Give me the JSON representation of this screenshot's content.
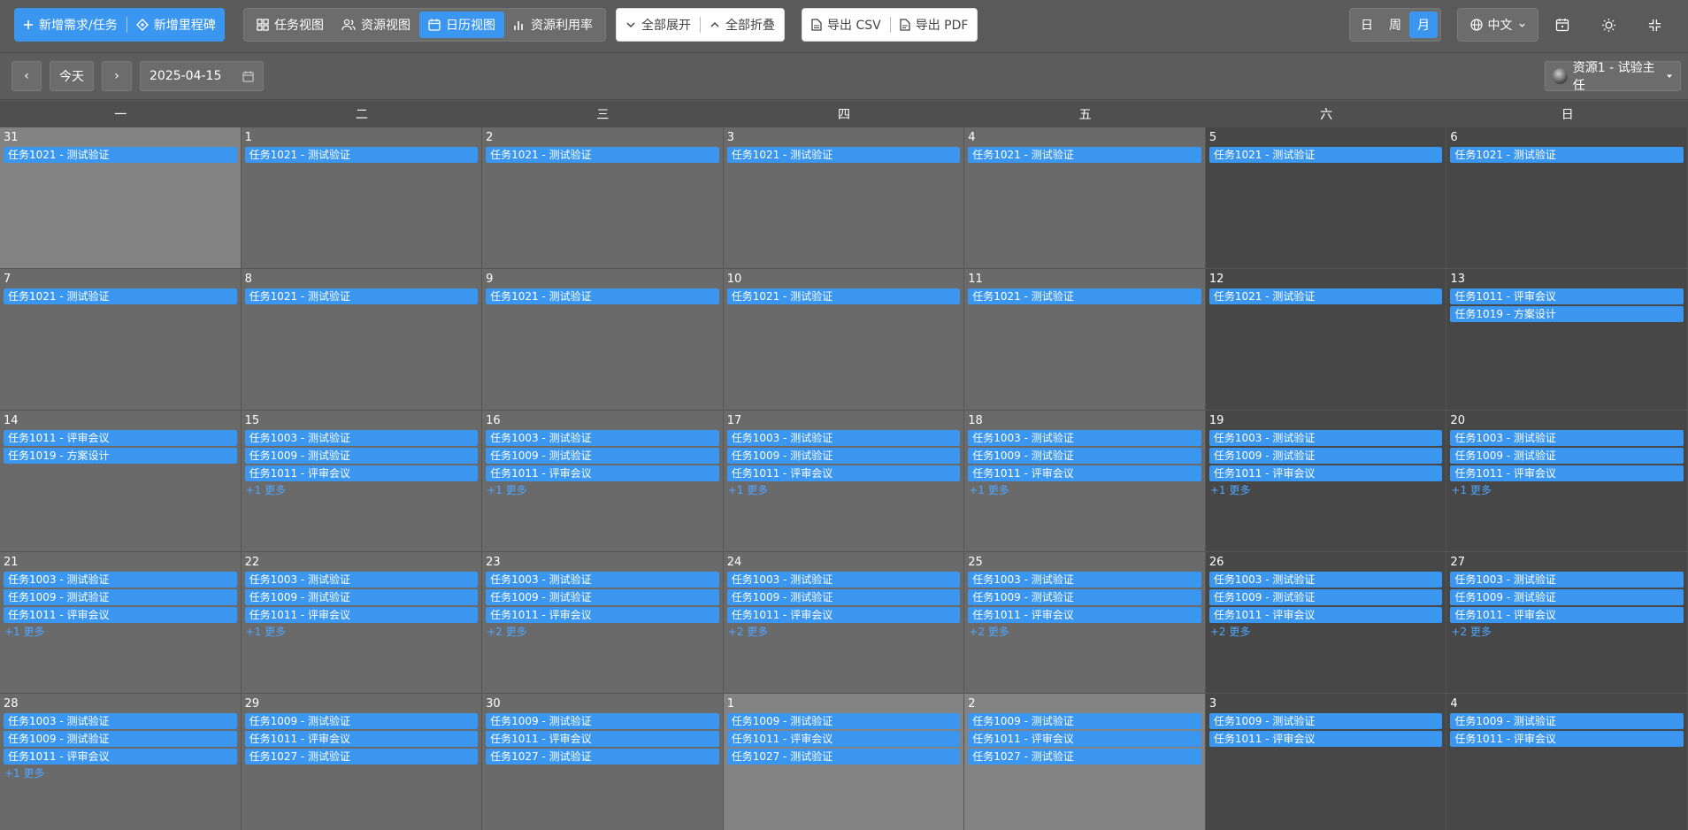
{
  "toolbar": {
    "add_task": "新增需求/任务",
    "add_milestone": "新增里程碑",
    "view_task": "任务视图",
    "view_resource": "资源视图",
    "view_calendar": "日历视图",
    "view_utilization": "资源利用率",
    "expand_all": "全部展开",
    "collapse_all": "全部折叠",
    "export_csv": "导出 CSV",
    "export_pdf": "导出 PDF",
    "period_day": "日",
    "period_week": "周",
    "period_month": "月",
    "language": "中文",
    "accent_color": "#3a96ee"
  },
  "subbar": {
    "prev": "‹",
    "today": "今天",
    "next": "›",
    "date": "2025-04-15",
    "resource": "资源1 - 试验主任"
  },
  "calendar": {
    "weekdays": [
      "一",
      "二",
      "三",
      "四",
      "五",
      "六",
      "日"
    ],
    "weeks": [
      [
        {
          "day": "31",
          "other": true,
          "events": [
            "任务1021 - 测试验证"
          ],
          "more": ""
        },
        {
          "day": "1",
          "events": [
            "任务1021 - 测试验证"
          ],
          "more": ""
        },
        {
          "day": "2",
          "events": [
            "任务1021 - 测试验证"
          ],
          "more": ""
        },
        {
          "day": "3",
          "events": [
            "任务1021 - 测试验证"
          ],
          "more": ""
        },
        {
          "day": "4",
          "events": [
            "任务1021 - 测试验证"
          ],
          "more": ""
        },
        {
          "day": "5",
          "events": [
            "任务1021 - 测试验证"
          ],
          "more": ""
        },
        {
          "day": "6",
          "events": [
            "任务1021 - 测试验证"
          ],
          "more": ""
        }
      ],
      [
        {
          "day": "7",
          "events": [
            "任务1021 - 测试验证"
          ],
          "more": ""
        },
        {
          "day": "8",
          "events": [
            "任务1021 - 测试验证"
          ],
          "more": ""
        },
        {
          "day": "9",
          "events": [
            "任务1021 - 测试验证"
          ],
          "more": ""
        },
        {
          "day": "10",
          "events": [
            "任务1021 - 测试验证"
          ],
          "more": ""
        },
        {
          "day": "11",
          "events": [
            "任务1021 - 测试验证"
          ],
          "more": ""
        },
        {
          "day": "12",
          "events": [
            "任务1021 - 测试验证"
          ],
          "more": ""
        },
        {
          "day": "13",
          "events": [
            "任务1011 - 评审会议",
            "任务1019 - 方案设计"
          ],
          "more": ""
        }
      ],
      [
        {
          "day": "14",
          "events": [
            "任务1011 - 评审会议",
            "任务1019 - 方案设计"
          ],
          "more": ""
        },
        {
          "day": "15",
          "events": [
            "任务1003 - 测试验证",
            "任务1009 - 测试验证",
            "任务1011 - 评审会议"
          ],
          "more": "+1 更多"
        },
        {
          "day": "16",
          "events": [
            "任务1003 - 测试验证",
            "任务1009 - 测试验证",
            "任务1011 - 评审会议"
          ],
          "more": "+1 更多"
        },
        {
          "day": "17",
          "events": [
            "任务1003 - 测试验证",
            "任务1009 - 测试验证",
            "任务1011 - 评审会议"
          ],
          "more": "+1 更多"
        },
        {
          "day": "18",
          "events": [
            "任务1003 - 测试验证",
            "任务1009 - 测试验证",
            "任务1011 - 评审会议"
          ],
          "more": "+1 更多"
        },
        {
          "day": "19",
          "events": [
            "任务1003 - 测试验证",
            "任务1009 - 测试验证",
            "任务1011 - 评审会议"
          ],
          "more": "+1 更多"
        },
        {
          "day": "20",
          "events": [
            "任务1003 - 测试验证",
            "任务1009 - 测试验证",
            "任务1011 - 评审会议"
          ],
          "more": "+1 更多"
        }
      ],
      [
        {
          "day": "21",
          "events": [
            "任务1003 - 测试验证",
            "任务1009 - 测试验证",
            "任务1011 - 评审会议"
          ],
          "more": "+1 更多"
        },
        {
          "day": "22",
          "events": [
            "任务1003 - 测试验证",
            "任务1009 - 测试验证",
            "任务1011 - 评审会议"
          ],
          "more": "+1 更多"
        },
        {
          "day": "23",
          "events": [
            "任务1003 - 测试验证",
            "任务1009 - 测试验证",
            "任务1011 - 评审会议"
          ],
          "more": "+2 更多"
        },
        {
          "day": "24",
          "events": [
            "任务1003 - 测试验证",
            "任务1009 - 测试验证",
            "任务1011 - 评审会议"
          ],
          "more": "+2 更多"
        },
        {
          "day": "25",
          "events": [
            "任务1003 - 测试验证",
            "任务1009 - 测试验证",
            "任务1011 - 评审会议"
          ],
          "more": "+2 更多"
        },
        {
          "day": "26",
          "events": [
            "任务1003 - 测试验证",
            "任务1009 - 测试验证",
            "任务1011 - 评审会议"
          ],
          "more": "+2 更多"
        },
        {
          "day": "27",
          "events": [
            "任务1003 - 测试验证",
            "任务1009 - 测试验证",
            "任务1011 - 评审会议"
          ],
          "more": "+2 更多"
        }
      ],
      [
        {
          "day": "28",
          "events": [
            "任务1003 - 测试验证",
            "任务1009 - 测试验证",
            "任务1011 - 评审会议"
          ],
          "more": "+1 更多"
        },
        {
          "day": "29",
          "events": [
            "任务1009 - 测试验证",
            "任务1011 - 评审会议",
            "任务1027 - 测试验证"
          ],
          "more": ""
        },
        {
          "day": "30",
          "events": [
            "任务1009 - 测试验证",
            "任务1011 - 评审会议",
            "任务1027 - 测试验证"
          ],
          "more": ""
        },
        {
          "day": "1",
          "other": true,
          "events": [
            "任务1009 - 测试验证",
            "任务1011 - 评审会议",
            "任务1027 - 测试验证"
          ],
          "more": ""
        },
        {
          "day": "2",
          "other": true,
          "events": [
            "任务1009 - 测试验证",
            "任务1011 - 评审会议",
            "任务1027 - 测试验证"
          ],
          "more": ""
        },
        {
          "day": "3",
          "other": true,
          "events": [
            "任务1009 - 测试验证",
            "任务1011 - 评审会议"
          ],
          "more": ""
        },
        {
          "day": "4",
          "other": true,
          "events": [
            "任务1009 - 测试验证",
            "任务1011 - 评审会议"
          ],
          "more": ""
        }
      ]
    ]
  }
}
